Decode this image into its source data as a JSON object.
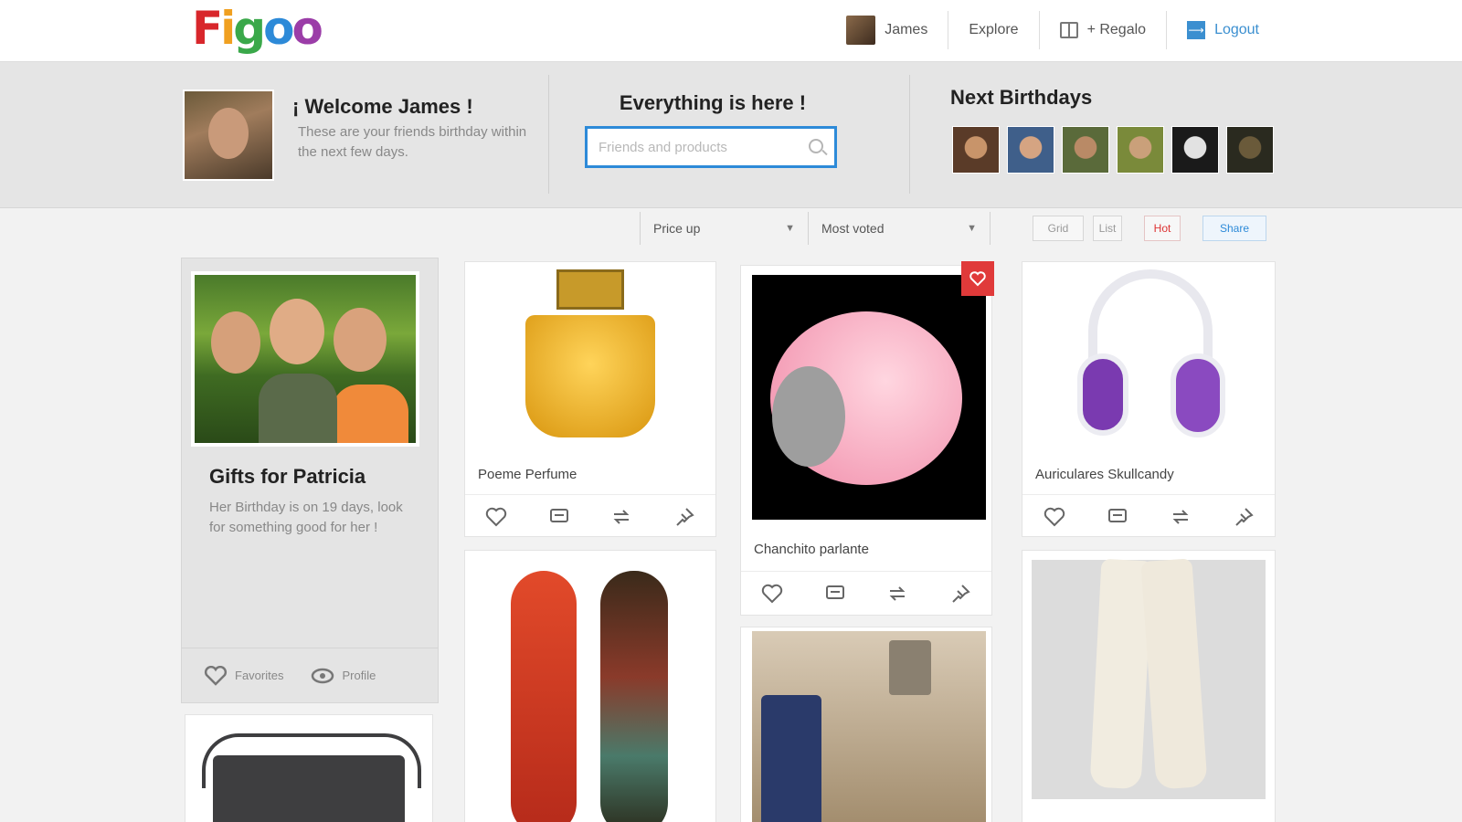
{
  "app": {
    "logo_letters": [
      "F",
      "i",
      "g",
      "o",
      "o"
    ],
    "logo_colors": [
      "#d8262b",
      "#f0a020",
      "#3aa84a",
      "#2d8ad8",
      "#9b3da8"
    ]
  },
  "nav": {
    "user_name": "James",
    "explore_label": "Explore",
    "gifts_label": "+ Regalo",
    "logout_label": "Logout"
  },
  "welcome": {
    "title": "¡ Welcome James !",
    "text": "These are your friends birthday within the next few days."
  },
  "search": {
    "heading": "Everything is here !",
    "placeholder": "Friends and products"
  },
  "birthdays": {
    "heading": "Next Birthdays",
    "faces": [
      [
        "#5a3b28",
        "#c8946a"
      ],
      [
        "#3f5f8a",
        "#d5a482"
      ],
      [
        "#5a6a3a",
        "#b98a66"
      ],
      [
        "#7a8a3a",
        "#caa07a"
      ],
      [
        "#1a1a1a",
        "#e2e2e2"
      ],
      [
        "#2a2a1f",
        "#6a5a3a"
      ]
    ]
  },
  "filters": {
    "price_label": "Price up",
    "sort_label": "Most voted",
    "tools": [
      "Grid",
      "List",
      "Hot",
      "Share"
    ]
  },
  "feature_card": {
    "title": "Gifts for Patricia",
    "text": "Her Birthday is on 19 days, look for something good for her !",
    "favorites_label": "Favorites",
    "profile_label": "Profile"
  },
  "products": [
    {
      "name": "Poeme Perfume"
    },
    {
      "name": "Skateboards"
    },
    {
      "name": "Chanchito parlante"
    },
    {
      "name": "Kitchen still life"
    },
    {
      "name": "Auriculares Skullcandy"
    },
    {
      "name": "White pants"
    },
    {
      "name": "Grey bag"
    }
  ],
  "colors": {
    "accent": "#2d8ad8",
    "alert": "#e03a3a"
  },
  "icons": [
    "heart-icon",
    "comment-icon",
    "share-icon",
    "pin-icon",
    "search-icon",
    "gift-icon",
    "logout-icon",
    "eye-icon"
  ]
}
